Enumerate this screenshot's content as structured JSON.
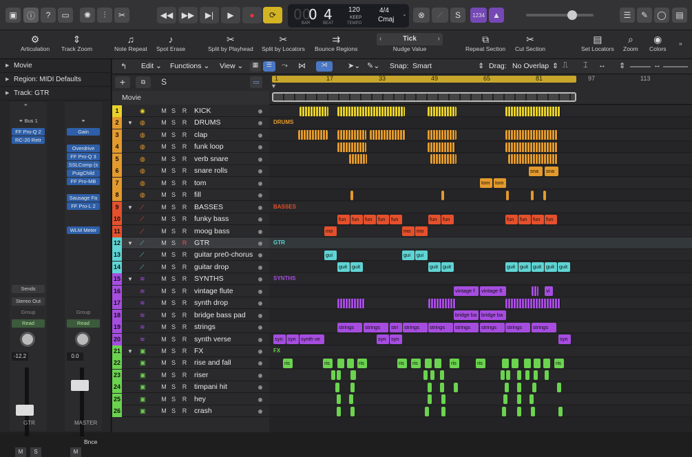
{
  "transport": {
    "lcd_bar": "0",
    "lcd_beat": "4",
    "lcd_bar_label": "BAR",
    "lcd_beat_label": "BEAT",
    "tempo": "120",
    "tempo_mode": "KEEP",
    "tempo_label": "TEMPO",
    "signature": "4/4",
    "key": "Cmaj",
    "count_in": "1234"
  },
  "toolbar": {
    "items": [
      {
        "label": "Articulation",
        "icon": "articulation-icon"
      },
      {
        "label": "Track Zoom",
        "icon": "track-zoom-icon"
      },
      {
        "label": "Note Repeat",
        "icon": "note-repeat-icon"
      },
      {
        "label": "Spot Erase",
        "icon": "spot-erase-icon"
      },
      {
        "label": "Split by Playhead",
        "icon": "split-playhead-icon"
      },
      {
        "label": "Split by Locators",
        "icon": "split-locators-icon"
      },
      {
        "label": "Bounce Regions",
        "icon": "bounce-regions-icon"
      },
      {
        "label": "Nudge Value",
        "icon": "nudge-value-icon"
      },
      {
        "label": "Repeat Section",
        "icon": "repeat-section-icon"
      },
      {
        "label": "Cut Section",
        "icon": "cut-section-icon"
      },
      {
        "label": "Set Locators",
        "icon": "set-locators-icon"
      },
      {
        "label": "Zoom",
        "icon": "zoom-icon"
      },
      {
        "label": "Colors",
        "icon": "colors-icon"
      }
    ],
    "nudge_value": "Tick"
  },
  "inspector": {
    "movie": "Movie",
    "region": "Region: MIDI Defaults",
    "track": "Track: GTR",
    "left_strip": {
      "output_label": "Bus 1",
      "plugins": [
        "FF Pro-Q 2",
        "RC-20 Retr"
      ],
      "sends": "Sends",
      "output": "Stereo Out",
      "group": "Group",
      "automation": "Read",
      "pan": "-12.2",
      "name": "GTR",
      "m": "M",
      "s": "S"
    },
    "right_strip": {
      "gain": "Gain",
      "plugins": [
        "Overdrive",
        "FF Pro-Q 3",
        "SSLComp (s",
        "PuigChild",
        "FF Pro-MB",
        "Sausage Fa",
        "FF Pro-L 2",
        "WLM Meter"
      ],
      "group": "Group",
      "automation": "Read",
      "pan": "0.0",
      "bounce": "Bnce",
      "name": "MASTER",
      "m": "M"
    }
  },
  "arrange": {
    "menus": [
      "Edit",
      "Functions",
      "View"
    ],
    "snap_label": "Snap:",
    "snap_value": "Smart",
    "drag_label": "Drag:",
    "drag_value": "No Overlap",
    "movie_label": "Movie",
    "ruler_marks": [
      "1",
      "17",
      "33",
      "49",
      "65",
      "81",
      "97",
      "113"
    ]
  },
  "colors": {
    "yellow": "#e8d22a",
    "orange": "#e39a2d",
    "red": "#e5502c",
    "teal": "#5fd4d4",
    "purple": "#a64de0",
    "green": "#6bd34f"
  },
  "tracks": [
    {
      "num": "1",
      "name": "KICK",
      "color": "#e8d22a",
      "folder": false,
      "icon": "kick-icon"
    },
    {
      "num": "2",
      "name": "DRUMS",
      "color": "#e39a2d",
      "folder": true,
      "icon": "drums-icon"
    },
    {
      "num": "3",
      "name": "clap",
      "color": "#e39a2d",
      "folder": false,
      "icon": "drums-icon"
    },
    {
      "num": "4",
      "name": "funk loop",
      "color": "#e39a2d",
      "folder": false,
      "icon": "drums-icon"
    },
    {
      "num": "5",
      "name": "verb snare",
      "color": "#e39a2d",
      "folder": false,
      "icon": "drums-icon"
    },
    {
      "num": "6",
      "name": "snare rolls",
      "color": "#e39a2d",
      "folder": false,
      "icon": "drums-icon"
    },
    {
      "num": "7",
      "name": "tom",
      "color": "#e39a2d",
      "folder": false,
      "icon": "drums-icon"
    },
    {
      "num": "8",
      "name": "fill",
      "color": "#e39a2d",
      "folder": false,
      "icon": "drums-icon"
    },
    {
      "num": "9",
      "name": "BASSES",
      "color": "#e5502c",
      "folder": true,
      "icon": "bass-icon"
    },
    {
      "num": "10",
      "name": "funky bass",
      "color": "#e5502c",
      "folder": false,
      "icon": "bass-icon"
    },
    {
      "num": "11",
      "name": "moog bass",
      "color": "#e5502c",
      "folder": false,
      "icon": "bass-icon"
    },
    {
      "num": "12",
      "name": "GTR",
      "color": "#5fd4d4",
      "folder": true,
      "icon": "guitar-icon"
    },
    {
      "num": "13",
      "name": "guitar pre0-chorus",
      "color": "#5fd4d4",
      "folder": false,
      "icon": "guitar-icon"
    },
    {
      "num": "14",
      "name": "guitar drop",
      "color": "#5fd4d4",
      "folder": false,
      "icon": "guitar-icon"
    },
    {
      "num": "15",
      "name": "SYNTHS",
      "color": "#a64de0",
      "folder": true,
      "icon": "synth-icon"
    },
    {
      "num": "16",
      "name": "vintage flute",
      "color": "#a64de0",
      "folder": false,
      "icon": "synth-icon"
    },
    {
      "num": "17",
      "name": "synth drop",
      "color": "#a64de0",
      "folder": false,
      "icon": "synth-icon"
    },
    {
      "num": "18",
      "name": "bridge bass pad",
      "color": "#a64de0",
      "folder": false,
      "icon": "synth-icon"
    },
    {
      "num": "19",
      "name": "strings",
      "color": "#a64de0",
      "folder": false,
      "icon": "synth-icon"
    },
    {
      "num": "20",
      "name": "synth verse",
      "color": "#a64de0",
      "folder": false,
      "icon": "synth-icon"
    },
    {
      "num": "21",
      "name": "FX",
      "color": "#6bd34f",
      "folder": true,
      "icon": "fx-icon"
    },
    {
      "num": "22",
      "name": "rise and fall",
      "color": "#6bd34f",
      "folder": false,
      "icon": "fx-icon"
    },
    {
      "num": "23",
      "name": "riser",
      "color": "#6bd34f",
      "folder": false,
      "icon": "fx-icon"
    },
    {
      "num": "24",
      "name": "timpani hit",
      "color": "#6bd34f",
      "folder": false,
      "icon": "fx-icon"
    },
    {
      "num": "25",
      "name": "hey",
      "color": "#6bd34f",
      "folder": false,
      "icon": "fx-icon"
    },
    {
      "num": "26",
      "name": "crash",
      "color": "#6bd34f",
      "folder": false,
      "icon": "fx-icon"
    }
  ],
  "folder_labels": {
    "drums": "DRUMS",
    "basses": "BASSES",
    "gtr": "GTR",
    "synths": "SYNTHS",
    "fx": "FX"
  },
  "region_labels": {
    "snare": "sna",
    "tom": "tom",
    "fun": "fun",
    "mo": "mo",
    "gui": "gui",
    "guit": "guit",
    "vintage": "vintage f",
    "vintage2": "vintage fl",
    "vi": "vi",
    "bridge": "bridge ba",
    "strings": "strings",
    "stri": "stri",
    "syn": "syn",
    "synth_ve": "synth ve",
    "ris": "ris"
  }
}
